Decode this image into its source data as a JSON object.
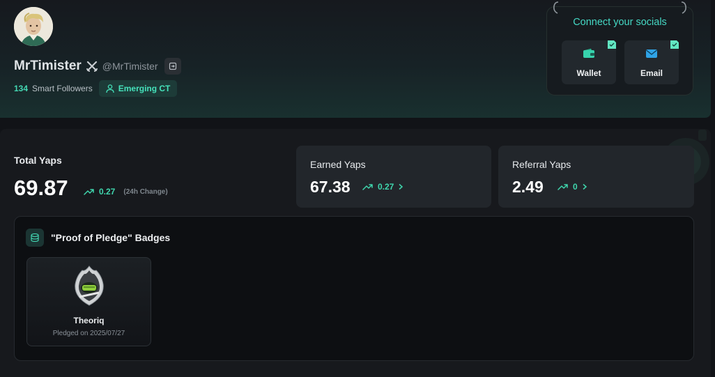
{
  "profile": {
    "name": "MrTimister",
    "handle": "@MrTimister",
    "smart_followers_count": "134",
    "smart_followers_label": "Smart Followers",
    "tag": "Emerging CT"
  },
  "socials": {
    "title": "Connect your socials",
    "buttons": [
      {
        "label": "Wallet",
        "icon": "wallet-icon",
        "connected": true
      },
      {
        "label": "Email",
        "icon": "mail-icon",
        "connected": true
      }
    ]
  },
  "yaps": {
    "total_label": "Total Yaps",
    "total_value": "69.87",
    "total_change": "0.27",
    "total_change_note": "(24h Change)",
    "earned_label": "Earned Yaps",
    "earned_value": "67.38",
    "earned_change": "0.27",
    "referral_label": "Referral Yaps",
    "referral_value": "2.49",
    "referral_change": "0"
  },
  "badges": {
    "title": "\"Proof of Pledge\" Badges",
    "items": [
      {
        "name": "Theoriq",
        "date": "Pledged on 2025/07/27"
      }
    ]
  },
  "colors": {
    "accent": "#44d8b3",
    "background": "#111317",
    "card": "#22262b"
  }
}
